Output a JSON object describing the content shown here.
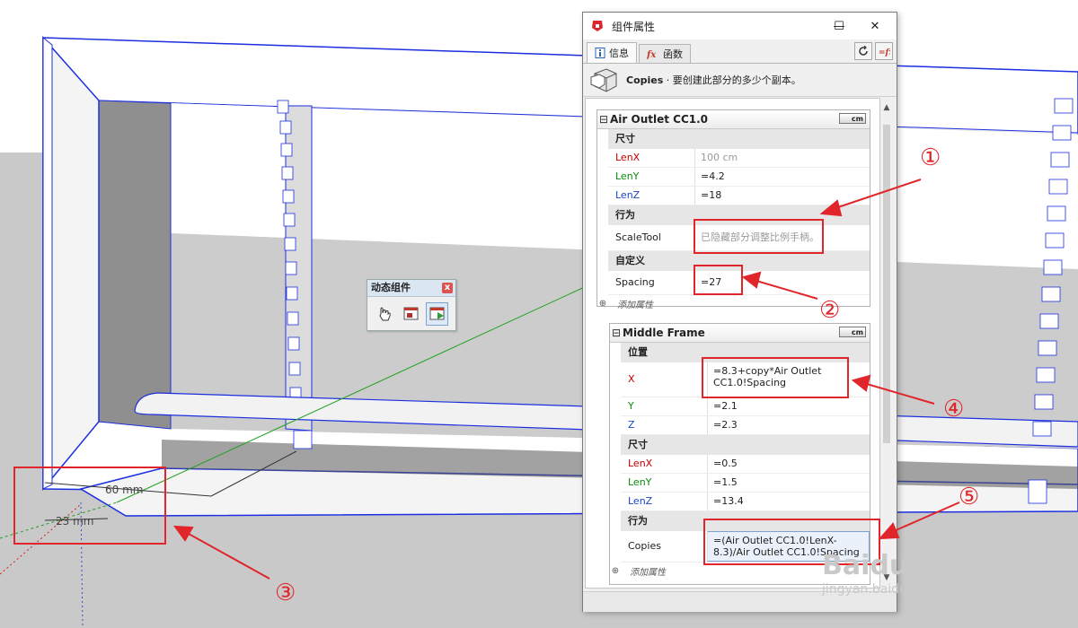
{
  "dialog": {
    "title": "组件属性",
    "tabs": [
      {
        "label": "信息"
      },
      {
        "label": "函数"
      }
    ],
    "info": {
      "name": "Copies",
      "description": " · 要创建此部分的多少个副本。"
    }
  },
  "components": [
    {
      "name": "Air Outlet CC1.0",
      "unit": "cm",
      "sections": [
        {
          "title": "尺寸",
          "rows": [
            {
              "label": "LenX",
              "value": "100 cm"
            },
            {
              "label": "LenY",
              "value": "=4.2"
            },
            {
              "label": "LenZ",
              "value": "=18"
            }
          ]
        },
        {
          "title": "行为",
          "rows": [
            {
              "label": "ScaleTool",
              "value": "已隐藏部分调整比例手柄。"
            }
          ]
        },
        {
          "title": "自定义",
          "rows": [
            {
              "label": "Spacing",
              "value": "=27"
            }
          ]
        }
      ],
      "add_attribute": "添加属性"
    },
    {
      "name": "Middle Frame",
      "unit": "cm",
      "sections": [
        {
          "title": "位置",
          "rows": [
            {
              "label": "X",
              "value": "=8.3+copy*Air Outlet CC1.0!Spacing"
            },
            {
              "label": "Y",
              "value": "=2.1"
            },
            {
              "label": "Z",
              "value": "=2.3"
            }
          ]
        },
        {
          "title": "尺寸",
          "rows": [
            {
              "label": "LenX",
              "value": "=0.5"
            },
            {
              "label": "LenY",
              "value": "=1.5"
            },
            {
              "label": "LenZ",
              "value": "=13.4"
            }
          ]
        },
        {
          "title": "行为",
          "rows": [
            {
              "label": "Copies",
              "value": "=(Air Outlet CC1.0!LenX-8.3)/Air Outlet CC1.0!Spacing"
            }
          ]
        }
      ],
      "add_attribute": "添加属性"
    }
  ],
  "toolbar": {
    "title": "动态组件",
    "close": "x"
  },
  "dimensions": {
    "width_label": "60 mm",
    "depth_label": "23 mm"
  },
  "callouts": {
    "c1": "①",
    "c2": "②",
    "c3": "③",
    "c4": "④",
    "c5": "⑤"
  },
  "watermark": {
    "logo": "Baidu经验",
    "url": "jingyan.baidu.com"
  },
  "colors": {
    "accent": "#e0262b",
    "selection": "#0000ff",
    "axis_green": "#20a020",
    "axis_red": "#d02020"
  }
}
